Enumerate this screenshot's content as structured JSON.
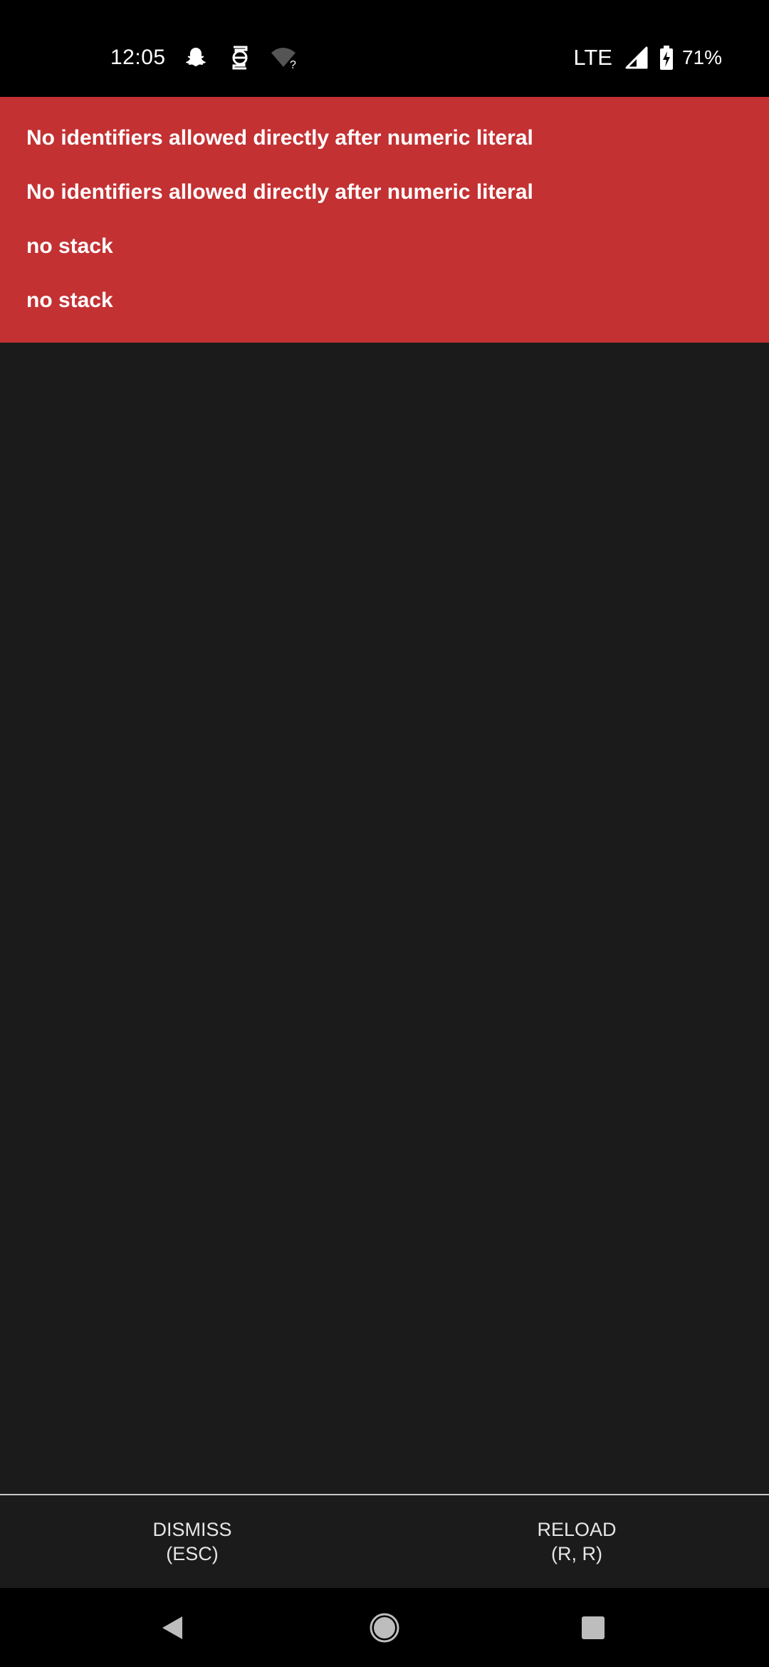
{
  "status_bar": {
    "time": "12:05",
    "network": "LTE",
    "battery_percent": "71%",
    "icons": [
      "snapchat-icon",
      "data-saver-icon",
      "wifi-unknown-icon",
      "signal-icon",
      "battery-charging-icon"
    ]
  },
  "error_panel": {
    "background_color": "#c33133",
    "messages": [
      "No identifiers allowed directly after numeric literal",
      "No identifiers allowed directly after numeric literal",
      "no stack",
      "no stack"
    ]
  },
  "actions": {
    "dismiss": {
      "label": "DISMISS",
      "shortcut": "(ESC)"
    },
    "reload": {
      "label": "RELOAD",
      "shortcut": "(R, R)"
    }
  },
  "nav_bar": {
    "icons": [
      "back-icon",
      "home-icon",
      "recents-icon"
    ]
  }
}
